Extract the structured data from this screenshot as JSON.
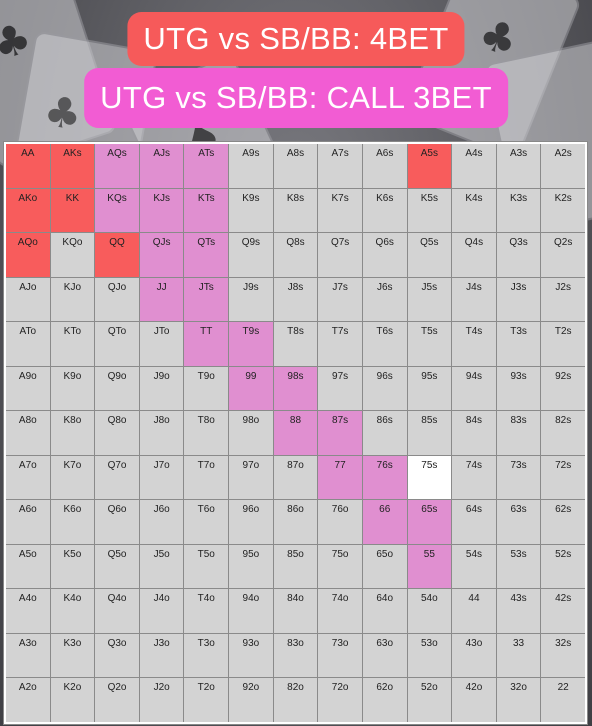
{
  "labels": {
    "top": "UTG vs SB/BB: 4BET",
    "bottom": "UTG vs SB/BB: CALL 3BET"
  },
  "colors": {
    "fourbet": "#f85c5c",
    "call": "#e08fd0",
    "default": "#d3d3d3",
    "blank": "#ffffff",
    "top_label_bg": "#f65a5a",
    "bottom_label_bg": "#f25cd3"
  },
  "legend_actions": {
    "R": "4bet",
    "C": "call 3bet",
    "N": "not in range",
    "W": "highlight"
  },
  "hands": [
    [
      "AA",
      "AKs",
      "AQs",
      "AJs",
      "ATs",
      "A9s",
      "A8s",
      "A7s",
      "A6s",
      "A5s",
      "A4s",
      "A3s",
      "A2s"
    ],
    [
      "AKo",
      "KK",
      "KQs",
      "KJs",
      "KTs",
      "K9s",
      "K8s",
      "K7s",
      "K6s",
      "K5s",
      "K4s",
      "K3s",
      "K2s"
    ],
    [
      "AQo",
      "KQo",
      "QQ",
      "QJs",
      "QTs",
      "Q9s",
      "Q8s",
      "Q7s",
      "Q6s",
      "Q5s",
      "Q4s",
      "Q3s",
      "Q2s"
    ],
    [
      "AJo",
      "KJo",
      "QJo",
      "JJ",
      "JTs",
      "J9s",
      "J8s",
      "J7s",
      "J6s",
      "J5s",
      "J4s",
      "J3s",
      "J2s"
    ],
    [
      "ATo",
      "KTo",
      "QTo",
      "JTo",
      "TT",
      "T9s",
      "T8s",
      "T7s",
      "T6s",
      "T5s",
      "T4s",
      "T3s",
      "T2s"
    ],
    [
      "A9o",
      "K9o",
      "Q9o",
      "J9o",
      "T9o",
      "99",
      "98s",
      "97s",
      "96s",
      "95s",
      "94s",
      "93s",
      "92s"
    ],
    [
      "A8o",
      "K8o",
      "Q8o",
      "J8o",
      "T8o",
      "98o",
      "88",
      "87s",
      "86s",
      "85s",
      "84s",
      "83s",
      "82s"
    ],
    [
      "A7o",
      "K7o",
      "Q7o",
      "J7o",
      "T7o",
      "97o",
      "87o",
      "77",
      "76s",
      "75s",
      "74s",
      "73s",
      "72s"
    ],
    [
      "A6o",
      "K6o",
      "Q6o",
      "J6o",
      "T6o",
      "96o",
      "86o",
      "76o",
      "66",
      "65s",
      "64s",
      "63s",
      "62s"
    ],
    [
      "A5o",
      "K5o",
      "Q5o",
      "J5o",
      "T5o",
      "95o",
      "85o",
      "75o",
      "65o",
      "55",
      "54s",
      "53s",
      "52s"
    ],
    [
      "A4o",
      "K4o",
      "Q4o",
      "J4o",
      "T4o",
      "94o",
      "84o",
      "74o",
      "64o",
      "54o",
      "44",
      "43s",
      "42s"
    ],
    [
      "A3o",
      "K3o",
      "Q3o",
      "J3o",
      "T3o",
      "93o",
      "83o",
      "73o",
      "63o",
      "53o",
      "43o",
      "33",
      "32s"
    ],
    [
      "A2o",
      "K2o",
      "Q2o",
      "J2o",
      "T2o",
      "92o",
      "82o",
      "72o",
      "62o",
      "52o",
      "42o",
      "32o",
      "22"
    ]
  ],
  "actions": [
    "RRCCCNNNNRNNN",
    "RRCCCNNNNNNNN",
    "RNRCCNNNNNNNN",
    "NNNCCNNNNNNNN",
    "NNNNCCNNNNNNN",
    "NNNNNCCNNNNNN",
    "NNNNNNCCNNNNN",
    "NNNNNNNCCWNNN",
    "NNNNNNNNCCNNN",
    "NNNNNNNNNCNNN",
    "NNNNNNNNNNNNN",
    "NNNNNNNNNNNNN",
    "NNNNNNNNNNNNN"
  ]
}
